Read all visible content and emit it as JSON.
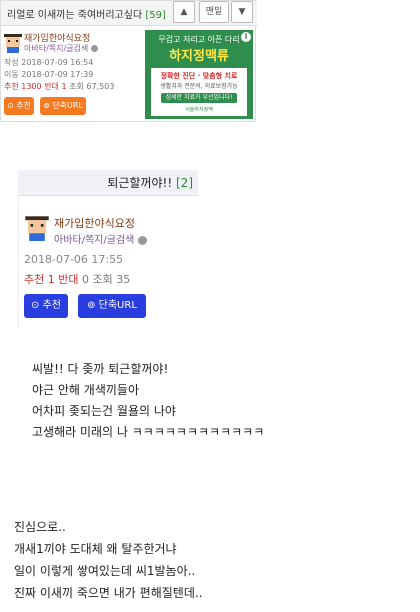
{
  "top_post": {
    "title": "리얼로 이새끼는 죽여버리고싶다",
    "comment_count": "[59]",
    "nav": {
      "up_symbol": "▲",
      "top_label": "맨밑",
      "down_symbol": "▼"
    },
    "author": "재가입한야식요정",
    "author_links": "아바타/쪽지/글검색",
    "written": "작성 2018-07-09 16:54",
    "moved": "이동 2018-07-09 17:39",
    "recommend_label": "추천",
    "recommend_count": "1300",
    "oppose_label": "반대",
    "oppose_count": "1",
    "views": "조회 67,503",
    "btn_recommend": "⊙ 추천",
    "btn_shorturl": "⊚ 단축URL",
    "accent": "#f47920"
  },
  "ad": {
    "line1": "무겁고 저리고 아픈 다리",
    "headline": "하지정맥류",
    "line3": "정확한 진단 · 맞춤형 치료",
    "line4": "생활치과 전문의, 의료보험가능",
    "cta": "섬세한 치료가 우선입니다!",
    "brand": "서울하지정맥",
    "info_symbol": "i"
  },
  "second_post": {
    "title": "퇴근할꺼야!!",
    "comment_count": "[2]",
    "author": "재가입한야식요정",
    "author_links": "아바타/쪽지/글검색",
    "date": "2018-07-06 17:55",
    "recommend_label": "추천",
    "recommend_count": "1",
    "oppose_label": "반대",
    "oppose_count": "0",
    "views": "조회 35",
    "btn_recommend": "⊙ 추천",
    "btn_shorturl": "⊚ 단축URL",
    "accent": "#2a3ee0"
  },
  "body_lines": [
    "씨발!! 다 좆까 퇴근할꺼야!",
    "야근 안해 개색끼들아",
    "어차피 좆되는건 월욜의 나야",
    "고생해라 미래의 나 ㅋㅋㅋㅋㅋㅋㅋㅋㅋㅋㅋㅋ"
  ],
  "body_lines2": [
    "진심으로..",
    "개새1끼야 도대체 왜 탈주한거냐",
    "일이 이렇게 쌓여있는데 씨1발놈아..",
    "진짜 이새끼 죽으면 내가 편해질텐데.."
  ]
}
